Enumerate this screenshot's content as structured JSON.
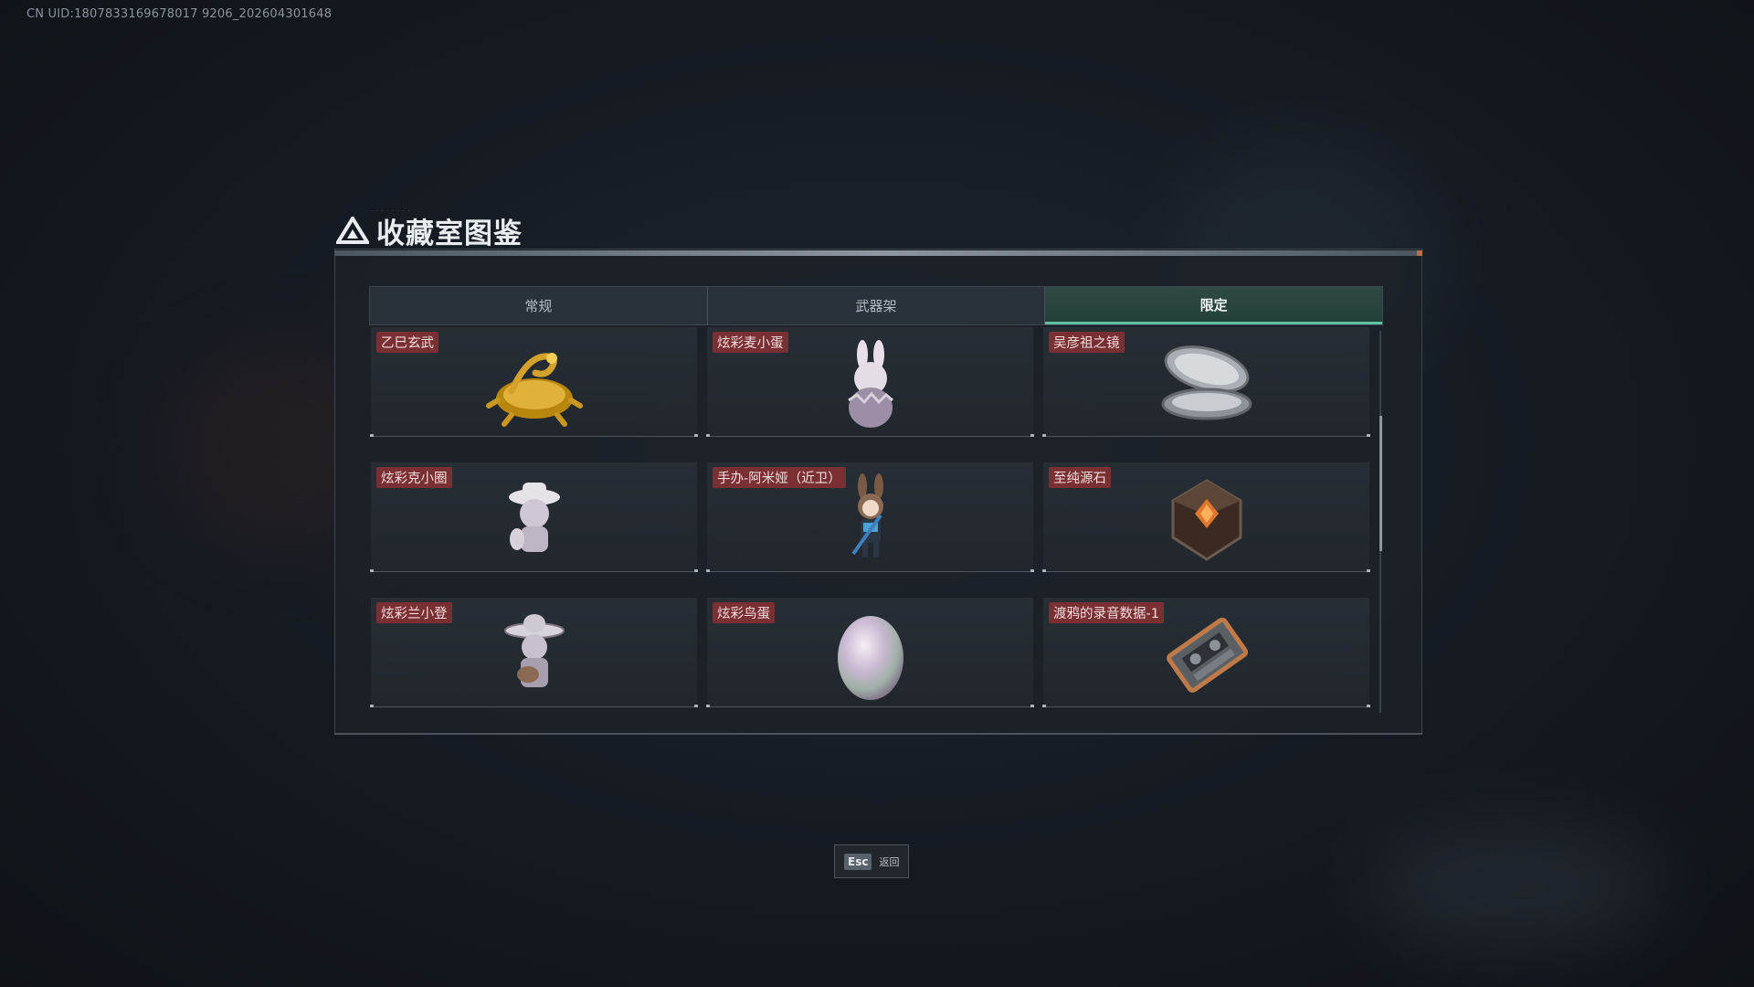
{
  "uid": "CN UID:1807833169678017 9206_202604301648",
  "header": {
    "title": "收藏室图鉴",
    "logo_icon": "triangle-logo-icon"
  },
  "tabs": [
    {
      "label": "常规",
      "active": false
    },
    {
      "label": "武器架",
      "active": false
    },
    {
      "label": "限定",
      "active": true
    }
  ],
  "collection": {
    "items": [
      {
        "name": "乙巳玄武",
        "icon": "golden-turtle-snake-icon"
      },
      {
        "name": "炫彩麦小蛋",
        "icon": "bunny-egg-figure-icon"
      },
      {
        "name": "吴彦祖之镜",
        "icon": "compact-mirror-icon"
      },
      {
        "name": "炫彩克小圈",
        "icon": "hat-figure-icon"
      },
      {
        "name": "手办-阿米娅（近卫）",
        "icon": "amiya-figure-icon"
      },
      {
        "name": "至纯源石",
        "icon": "originium-crystal-icon"
      },
      {
        "name": "炫彩兰小登",
        "icon": "sombrero-figure-icon"
      },
      {
        "name": "炫彩鸟蛋",
        "icon": "pearl-egg-icon"
      },
      {
        "name": "渡鸦的录音数据-1",
        "icon": "cassette-tape-icon"
      }
    ]
  },
  "footer": {
    "esc_key": "Esc",
    "esc_label": "返回"
  },
  "colors": {
    "accent": "#5fc2a2",
    "name_tag": "#7a2f33",
    "panel": "#1c2228"
  }
}
